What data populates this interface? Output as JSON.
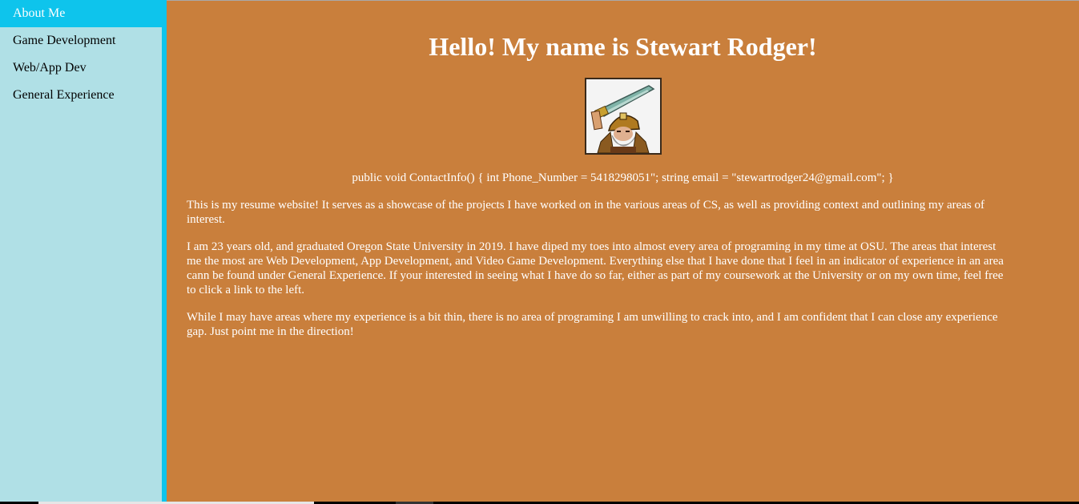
{
  "sidebar": {
    "items": [
      {
        "label": "About Me",
        "active": true
      },
      {
        "label": "Game Development"
      },
      {
        "label": "Web/App Dev"
      },
      {
        "label": "General Experience"
      }
    ]
  },
  "main": {
    "title": "Hello! My name is Stewart Rodger!",
    "avatar_icon": "warrior-avatar-icon",
    "contact": "public void ContactInfo() { int Phone_Number = 5418298051\"; string email = \"stewartrodger24@gmail.com\"; }",
    "paragraphs": [
      "This is my resume website! It serves as a showcase of the projects I have worked on in the various areas of CS, as well as providing context and outlining my areas of interest.",
      "I am 23 years old, and graduated Oregon State University in 2019. I have diped my toes into almost every area of programing in my time at OSU. The areas that interest me the most are Web Development, App Development, and Video Game Development. Everything else that I have done that I feel in an indicator of experience in an area cann be found under General Experience. If your interested in seeing what I have do so far, either as part of my coursework at the University or on my own time, feel free to click a link to the left.",
      "While I may have areas where my experience is a bit thin, there is no area of programing I am unwilling to crack into, and I am confident that I can close any experience gap. Just point me in the direction!"
    ]
  },
  "colors": {
    "sidebar_bg": "#b0e0e6",
    "accent": "#0ec4ec",
    "main_bg": "#c97f3c",
    "text_light": "#ffffff"
  }
}
